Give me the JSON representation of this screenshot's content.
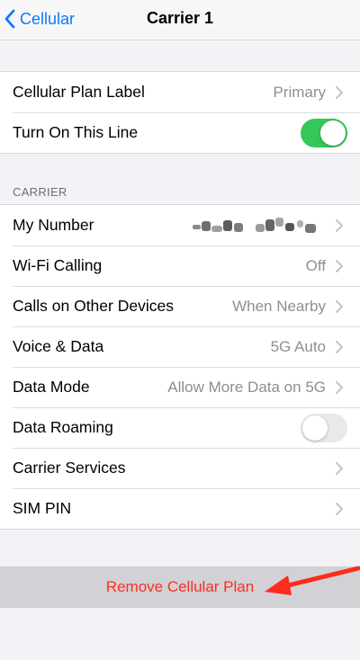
{
  "nav": {
    "back_label": "Cellular",
    "title": "Carrier 1"
  },
  "group1": {
    "plan_label": "Cellular Plan Label",
    "plan_value": "Primary",
    "line_label": "Turn On This Line",
    "line_on": true
  },
  "carrier_header": "CARRIER",
  "carrier": {
    "my_number_label": "My Number",
    "wifi_calling_label": "Wi-Fi Calling",
    "wifi_calling_value": "Off",
    "other_devices_label": "Calls on Other Devices",
    "other_devices_value": "When Nearby",
    "voice_data_label": "Voice & Data",
    "voice_data_value": "5G Auto",
    "data_mode_label": "Data Mode",
    "data_mode_value": "Allow More Data on 5G",
    "roaming_label": "Data Roaming",
    "roaming_on": false,
    "carrier_services_label": "Carrier Services",
    "sim_pin_label": "SIM PIN"
  },
  "remove_label": "Remove Cellular Plan",
  "colors": {
    "accent": "#0a7aff",
    "toggle_on": "#34c759",
    "destructive": "#ff2d20",
    "annotation_arrow": "#ff2b1c"
  },
  "icons": [
    "back-chevron-icon",
    "chevron-right-icon",
    "red-arrow-annotation-icon"
  ]
}
